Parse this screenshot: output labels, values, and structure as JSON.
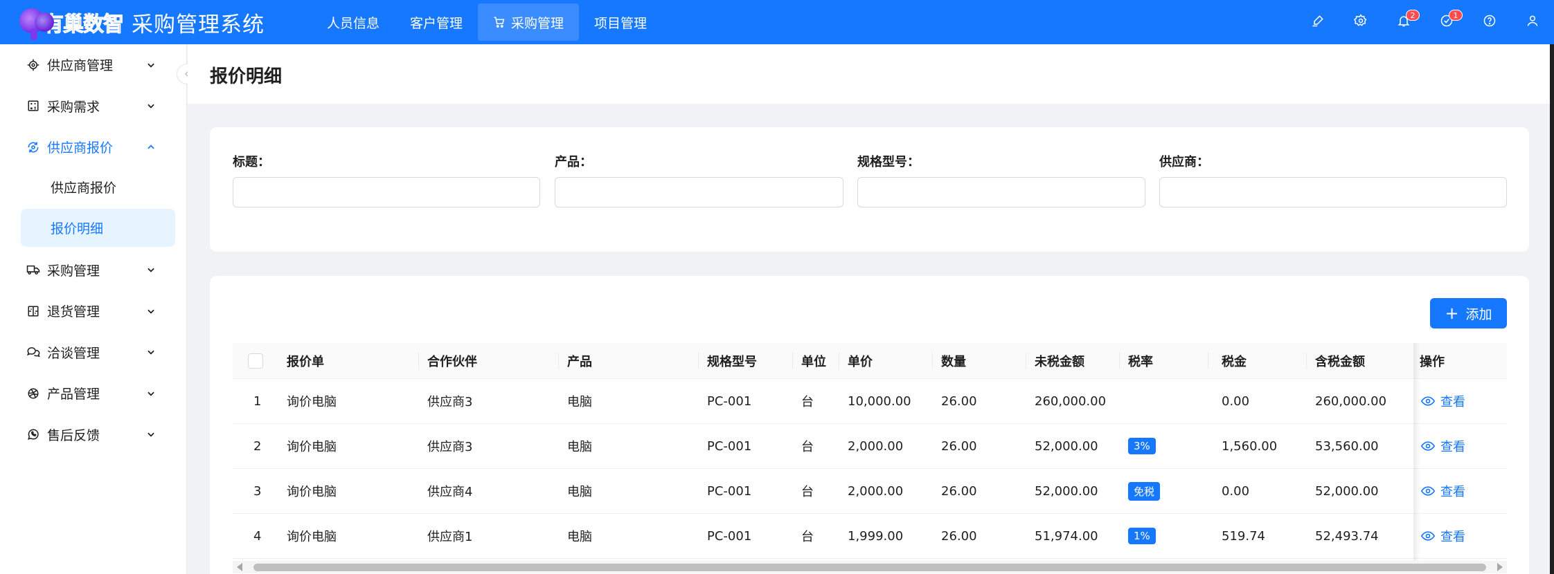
{
  "app": {
    "brand": "有巢数智",
    "title": "采购管理系统"
  },
  "topnav": [
    {
      "label": "人员信息"
    },
    {
      "label": "客户管理"
    },
    {
      "label": "采购管理",
      "active": true
    },
    {
      "label": "项目管理"
    }
  ],
  "header_icons": {
    "notifications_badge": "2",
    "tasks_badge": "1"
  },
  "sidebar": {
    "items": [
      {
        "label": "供应商管理",
        "icon": "target-icon"
      },
      {
        "label": "采购需求",
        "icon": "calculator-icon"
      },
      {
        "label": "供应商报价",
        "icon": "eye-refresh-icon",
        "open": true,
        "children": [
          {
            "label": "供应商报价"
          },
          {
            "label": "报价明细",
            "active": true
          }
        ]
      },
      {
        "label": "采购管理",
        "icon": "truck-icon"
      },
      {
        "label": "退货管理",
        "icon": "return-box-icon"
      },
      {
        "label": "洽谈管理",
        "icon": "chat-icon"
      },
      {
        "label": "产品管理",
        "icon": "dribbble-icon"
      },
      {
        "label": "售后反馈",
        "icon": "whatsapp-icon"
      }
    ]
  },
  "page": {
    "title": "报价明细"
  },
  "search": {
    "fields": [
      {
        "label": "标题：",
        "value": ""
      },
      {
        "label": "产品：",
        "value": ""
      },
      {
        "label": "规格型号：",
        "value": ""
      },
      {
        "label": "供应商：",
        "value": ""
      }
    ]
  },
  "table": {
    "add_label": "添加",
    "columns": [
      "报价单",
      "合作伙伴",
      "产品",
      "规格型号",
      "单位",
      "单价",
      "数量",
      "未税金额",
      "税率",
      "税金",
      "含税金额",
      "操作"
    ],
    "rows": [
      {
        "index": "1",
        "quote": "询价电脑",
        "partner": "供应商3",
        "product": "电脑",
        "spec": "PC-001",
        "unit": "台",
        "price": "10,000.00",
        "qty": "26.00",
        "pretax": "260,000.00",
        "tax_rate": "",
        "tax": "0.00",
        "total": "260,000.00",
        "action": "查看"
      },
      {
        "index": "2",
        "quote": "询价电脑",
        "partner": "供应商3",
        "product": "电脑",
        "spec": "PC-001",
        "unit": "台",
        "price": "2,000.00",
        "qty": "26.00",
        "pretax": "52,000.00",
        "tax_rate": "3%",
        "tax": "1,560.00",
        "total": "53,560.00",
        "action": "查看"
      },
      {
        "index": "3",
        "quote": "询价电脑",
        "partner": "供应商4",
        "product": "电脑",
        "spec": "PC-001",
        "unit": "台",
        "price": "2,000.00",
        "qty": "26.00",
        "pretax": "52,000.00",
        "tax_rate": "免税",
        "tax": "0.00",
        "total": "52,000.00",
        "action": "查看"
      },
      {
        "index": "4",
        "quote": "询价电脑",
        "partner": "供应商1",
        "product": "电脑",
        "spec": "PC-001",
        "unit": "台",
        "price": "1,999.00",
        "qty": "26.00",
        "pretax": "51,974.00",
        "tax_rate": "1%",
        "tax": "519.74",
        "total": "52,493.74",
        "action": "查看"
      }
    ]
  },
  "colors": {
    "primary": "#1677ff",
    "header_bg": "#1677ff",
    "active_bg": "#e6f4ff",
    "badge": "#ff4d4f"
  }
}
